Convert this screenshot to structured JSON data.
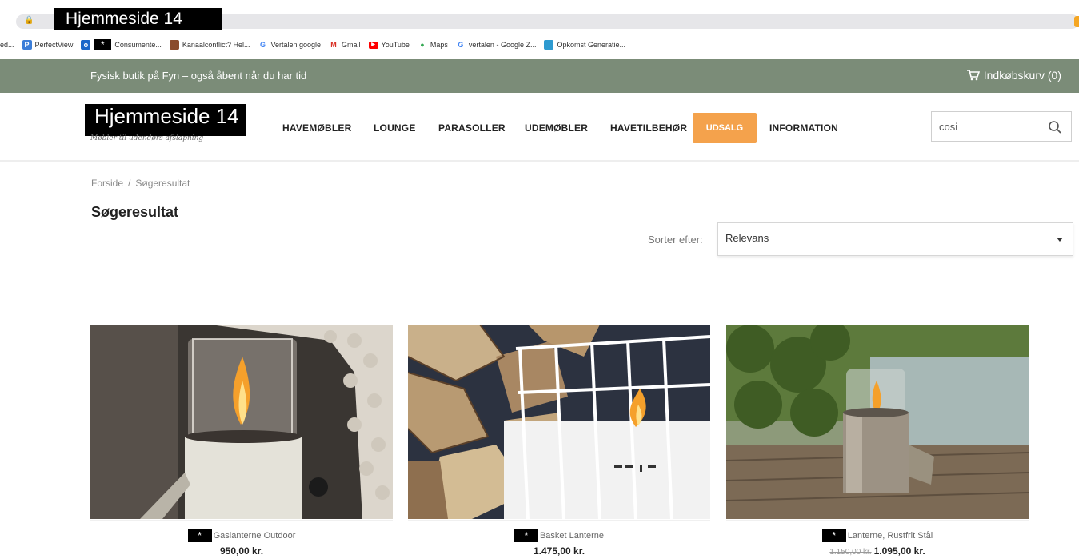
{
  "browser": {
    "tab_title": "Hjemmeside 14",
    "bookmarks": [
      {
        "label": "ed...",
        "icon": "bookmark-icon",
        "color": ""
      },
      {
        "label": "PerfectView",
        "icon": "perfectview-icon",
        "color": "#3b7dd8"
      },
      {
        "label": "Consumente...",
        "icon": "outlook-icon",
        "color": "#1a66c9",
        "redacted": "*"
      },
      {
        "label": "Kanaalconflict? Hel...",
        "icon": "book-icon",
        "color": "#8a4b2c"
      },
      {
        "label": "Vertalen google",
        "icon": "google-icon",
        "color": "#4285f4"
      },
      {
        "label": "Gmail",
        "icon": "gmail-icon",
        "color": "#d93025"
      },
      {
        "label": "YouTube",
        "icon": "youtube-icon",
        "color": "#ff0000"
      },
      {
        "label": "Maps",
        "icon": "maps-icon",
        "color": "#34a853"
      },
      {
        "label": "vertalen - Google Z...",
        "icon": "google-icon",
        "color": "#4285f4"
      },
      {
        "label": "Opkomst Generatie...",
        "icon": "bookmark-square-icon",
        "color": "#2e9ad0"
      }
    ]
  },
  "topbar": {
    "tagline": "Fysisk butik på Fyn – også åbent når du har tid",
    "cart_label": "Indkøbskurv (0)"
  },
  "header": {
    "logo_text": "Hjemmeside 14",
    "logo_sub": "Møbler til udendørs afslapning",
    "nav": [
      {
        "label": "HAVEMØBLER"
      },
      {
        "label": "LOUNGE"
      },
      {
        "label": "PARASOLLER"
      },
      {
        "label": "UDEMØBLER"
      },
      {
        "label": "HAVETILBEHØR"
      },
      {
        "label": "UDSALG"
      },
      {
        "label": "INFORMATION"
      }
    ],
    "search_value": "cosi",
    "sale_color": "#f4a24c"
  },
  "breadcrumb": {
    "home": "Forside",
    "separator": "/",
    "current": "Søgeresultat"
  },
  "page_title": "Søgeresultat",
  "sort": {
    "label": "Sorter efter:",
    "value": "Relevans"
  },
  "products": [
    {
      "redacted": "*",
      "name": "Gaslanterne Outdoor",
      "price": "950,00 kr.",
      "old_price": ""
    },
    {
      "redacted": "*",
      "name": "Basket Lanterne",
      "price": "1.475,00 kr.",
      "old_price": ""
    },
    {
      "redacted": "*",
      "name": "Lanterne, Rustfrit Stål",
      "price": "1.095,00 kr.",
      "old_price": "1.150,00 kr."
    }
  ],
  "colors": {
    "topbar": "#7b8c78",
    "accent": "#f4a24c"
  }
}
